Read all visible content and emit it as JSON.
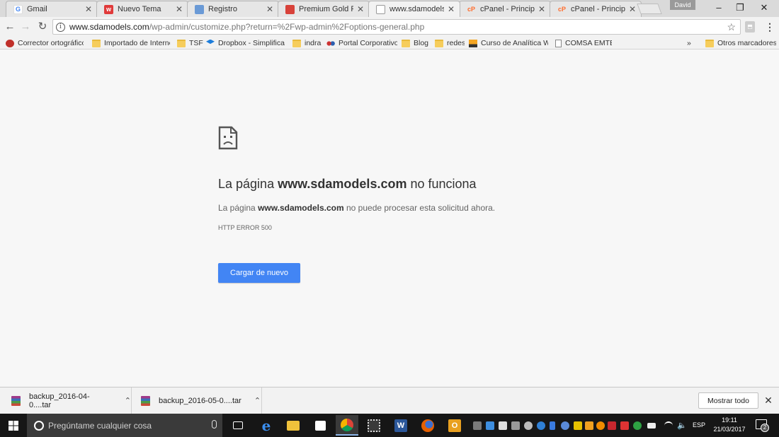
{
  "tabs": [
    {
      "title": "Gmail",
      "favicon": "G",
      "color": "#ffffff",
      "active": false
    },
    {
      "title": "Nuevo Tema",
      "favicon": "w",
      "color": "#e03a3a",
      "active": false
    },
    {
      "title": "Registro",
      "favicon": "",
      "color": "#6a9ad6",
      "active": false
    },
    {
      "title": "Premium Gold Ref",
      "favicon": "",
      "color": "#d8423a",
      "active": false
    },
    {
      "title": "www.sdamodels.co",
      "favicon": "",
      "color": "#ffffff",
      "active": true
    },
    {
      "title": "cPanel - Principal",
      "favicon": "cP",
      "color": "#ff6c2c",
      "active": false
    },
    {
      "title": "cPanel - Principal",
      "favicon": "cP",
      "color": "#ff6c2c",
      "active": false
    }
  ],
  "profile": "David",
  "window_controls": {
    "minimize": "–",
    "maximize": "❐",
    "close": "✕"
  },
  "address_bar": {
    "host": "www.sdamodels.com",
    "path": "/wp-admin/customize.php?return=%2Fwp-admin%2Foptions-general.php"
  },
  "bookmarks": [
    {
      "label": "Corrector ortográfico",
      "icon": "abc-icon"
    },
    {
      "label": "Importado de Internet",
      "icon": "folder-icon"
    },
    {
      "label": "TSF",
      "icon": "folder-icon"
    },
    {
      "label": "Dropbox - Simplifica tu",
      "icon": "dropbox-icon"
    },
    {
      "label": "indra",
      "icon": "folder-icon"
    },
    {
      "label": "Portal Corporativo",
      "icon": "portal-icon"
    },
    {
      "label": "Blog",
      "icon": "folder-icon"
    },
    {
      "label": "redes",
      "icon": "folder-icon"
    },
    {
      "label": "Curso de Analítica Web",
      "icon": "course-icon"
    },
    {
      "label": "COMSA EMTE",
      "icon": "page-icon"
    }
  ],
  "bookmarks_overflow": "»",
  "other_bookmarks": "Otros marcadores",
  "error": {
    "title_prefix": "La página ",
    "title_host": "www.sdamodels.com",
    "title_suffix": " no funciona",
    "desc_prefix": "La página ",
    "desc_host": "www.sdamodels.com",
    "desc_suffix": " no puede procesar esta solicitud ahora.",
    "code": "HTTP ERROR 500",
    "reload_label": "Cargar de nuevo"
  },
  "downloads": [
    {
      "filename": "backup_2016-04-0....tar"
    },
    {
      "filename": "backup_2016-05-0....tar"
    }
  ],
  "show_all_label": "Mostrar todo",
  "taskbar": {
    "search_placeholder": "Pregúntame cualquier cosa",
    "language": "ESP",
    "time": "19:11",
    "date": "21/03/2017",
    "notification_count": "2"
  }
}
